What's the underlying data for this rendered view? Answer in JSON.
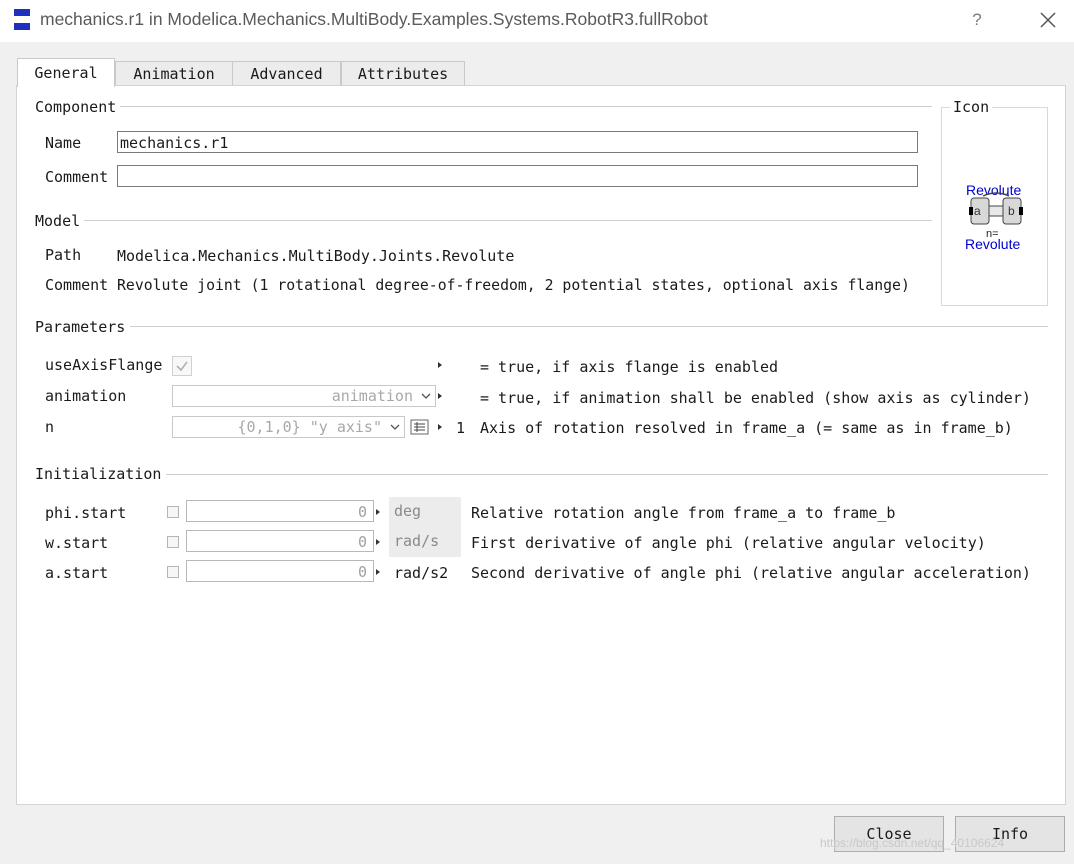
{
  "window": {
    "title": "mechanics.r1 in Modelica.Mechanics.MultiBody.Examples.Systems.RobotR3.fullRobot",
    "help_label": "?"
  },
  "tabs": [
    {
      "label": "General",
      "active": true
    },
    {
      "label": "Animation",
      "active": false
    },
    {
      "label": "Advanced",
      "active": false
    },
    {
      "label": "Attributes",
      "active": false
    }
  ],
  "component": {
    "section_label": "Component",
    "name_label": "Name",
    "name_value": "mechanics.r1",
    "comment_label": "Comment",
    "comment_value": ""
  },
  "icon_panel": {
    "section_label": "Icon",
    "top_text": "Revolute",
    "bottom_text": "Revolute",
    "port_a": "a",
    "port_b": "b",
    "n_text": "n=",
    "accent": "#0000cc"
  },
  "model": {
    "section_label": "Model",
    "path_label": "Path",
    "path_value": "Modelica.Mechanics.MultiBody.Joints.Revolute",
    "comment_label": "Comment",
    "comment_value": "Revolute joint (1 rotational degree-of-freedom, 2 potential states, optional axis flange)"
  },
  "parameters": {
    "section_label": "Parameters",
    "rows": [
      {
        "name": "useAxisFlange",
        "control": "checkbox",
        "checked": true,
        "unit": "",
        "description": "= true, if axis flange is enabled"
      },
      {
        "name": "animation",
        "control": "combo",
        "value": "animation",
        "unit": "",
        "description": "= true, if animation shall be enabled (show axis as cylinder)"
      },
      {
        "name": "n",
        "control": "combo",
        "value": "{0,1,0} \"y axis\"",
        "unit": "1",
        "description": "Axis of rotation resolved in frame_a (= same as in frame_b)"
      }
    ]
  },
  "initialization": {
    "section_label": "Initialization",
    "rows": [
      {
        "name": "phi.start",
        "value": "0",
        "unit": "deg",
        "description": "Relative rotation angle from frame_a to frame_b"
      },
      {
        "name": "w.start",
        "value": "0",
        "unit": "rad/s",
        "description": "First derivative of angle phi (relative angular velocity)"
      },
      {
        "name": "a.start",
        "value": "0",
        "unit": "rad/s2",
        "description": "Second derivative of angle phi (relative angular acceleration)"
      }
    ]
  },
  "buttons": {
    "close_label": "Close",
    "info_label": "Info"
  },
  "watermark": "https://blog.csdn.net/qq_40106624"
}
